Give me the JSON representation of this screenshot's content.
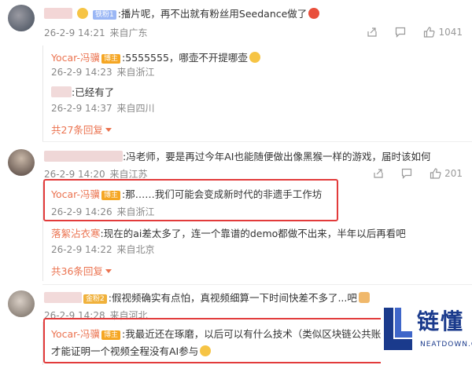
{
  "colors": {
    "accent": "#eb7350",
    "highlight": "#e23b3b",
    "logo": "#1a3a8c"
  },
  "comments": [
    {
      "badge": "铁粉1",
      "text": ":播片呢，再不出就有粉丝用Seedance做了",
      "time": "26-2-9 14:21",
      "location": "来自广东",
      "likes": "1041",
      "replies": [
        {
          "name": "Yocar-冯骥",
          "badge": "博主",
          "text": ":5555555，哪壶不开提哪壶",
          "time": "26-2-9 14:23",
          "location": "来自浙江"
        },
        {
          "text": ":已经有了",
          "time": "26-2-9 14:37",
          "location": "来自四川"
        }
      ],
      "more": "共27条回复"
    },
    {
      "text": ":冯老师，要是再过今年AI也能随便做出像黑猴一样的游戏，届时该如何",
      "time": "26-2-9 14:20",
      "location": "来自江苏",
      "likes": "201",
      "replies": [
        {
          "name": "Yocar-冯骥",
          "badge": "博主",
          "text": ":那……我们可能会变成新时代的非遗手工作坊",
          "time": "26-2-9 14:26",
          "location": "来自浙江"
        },
        {
          "name": "落絮沾衣寒",
          "text": ":现在的ai差太多了，连一个靠谱的demo都做不出来，半年以后再看吧",
          "time": "26-2-9 14:22",
          "location": "来自北京"
        }
      ],
      "more": "共36条回复"
    },
    {
      "badge": "金粉2",
      "text": ":假视频确实有点怕，真视频细算一下时间快差不多了...吧",
      "time": "26-2-9 14:28",
      "location": "来自河北",
      "replies": [
        {
          "name": "Yocar-冯骥",
          "badge": "博主",
          "text": ":我最近还在琢磨，以后可以有什么技术（类似区块链公共账",
          "text2": "才能证明一个视频全程没有AI参与"
        }
      ]
    }
  ],
  "watermark": {
    "name": "链懂",
    "site": "NEATDOWN.COM"
  }
}
